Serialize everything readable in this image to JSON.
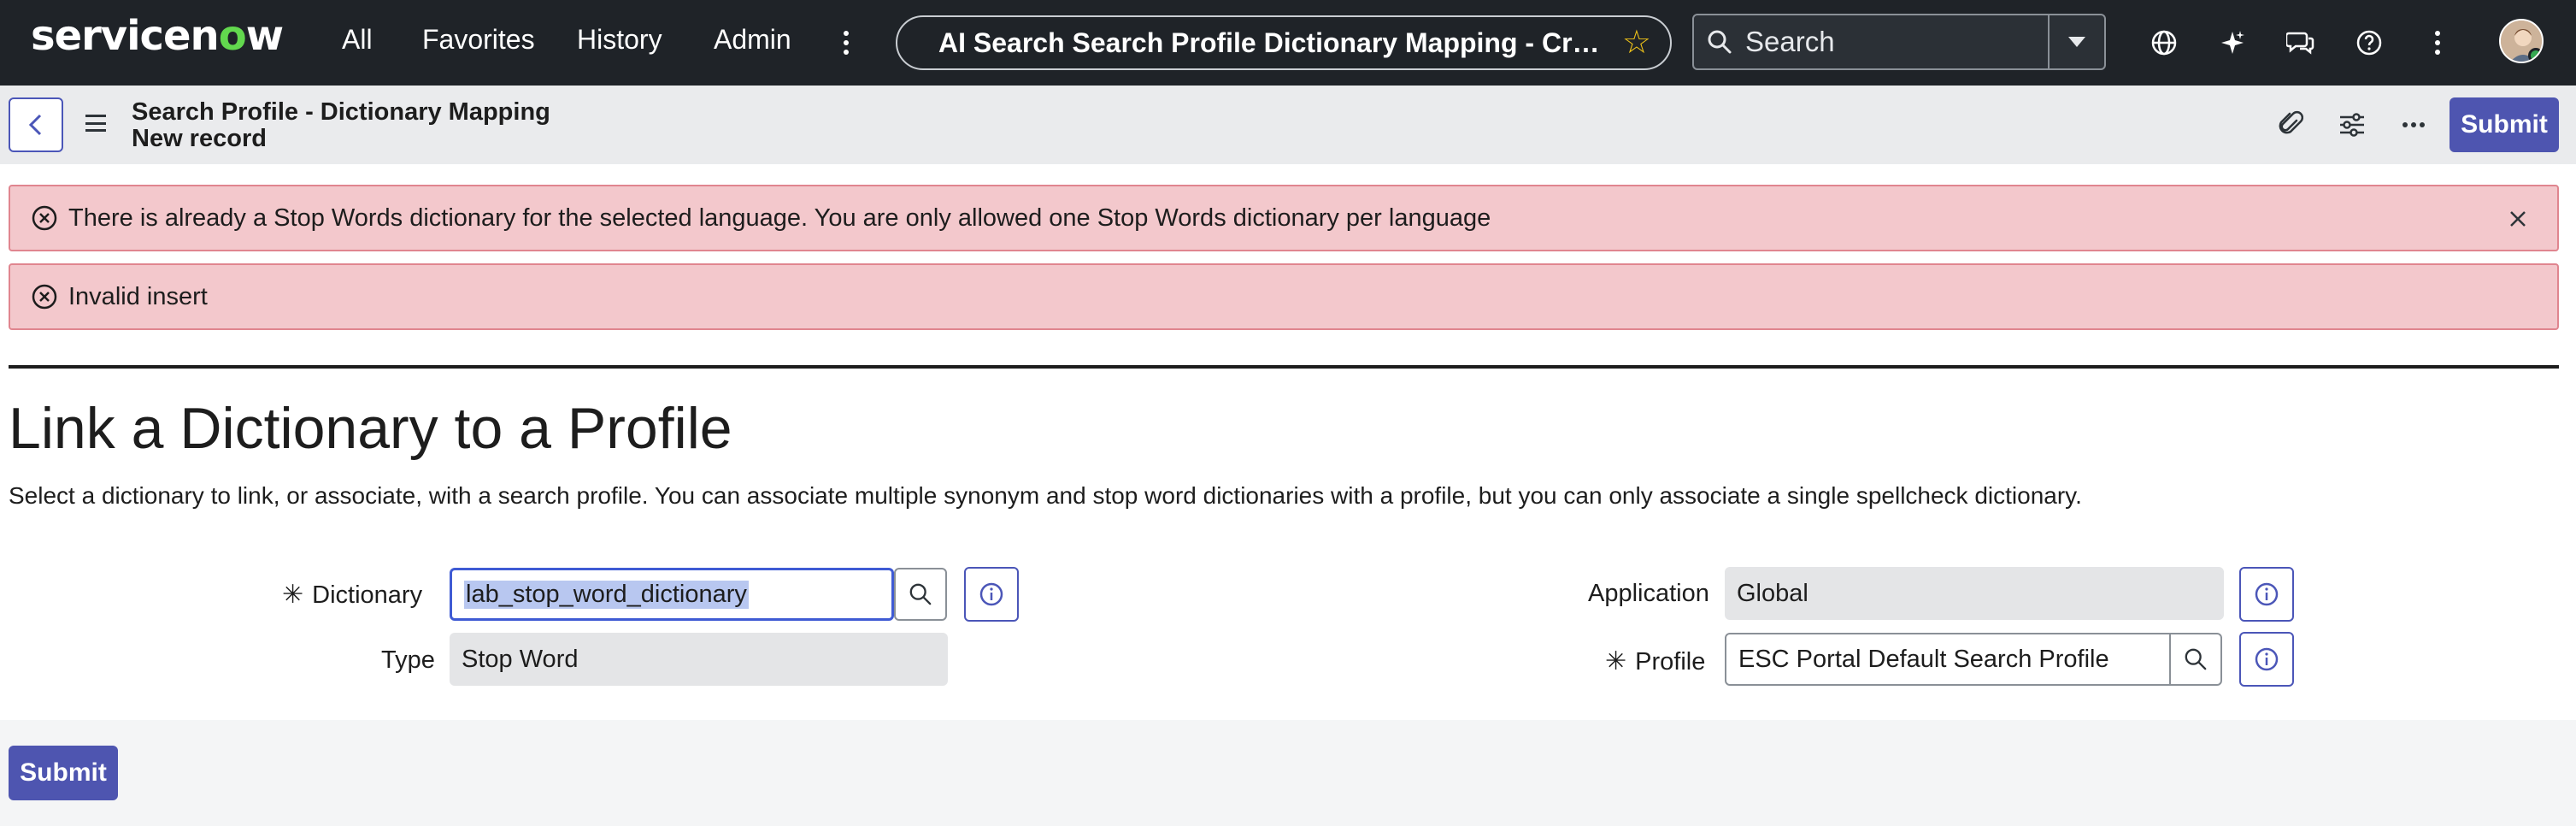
{
  "nav": {
    "logo_prefix": "servicen",
    "logo_o": "o",
    "logo_suffix": "w",
    "links": [
      "All",
      "Favorites",
      "History",
      "Admin"
    ],
    "page_title": "AI Search Search Profile Dictionary Mapping - Create…",
    "search_placeholder": "Search",
    "icons": [
      "globe-icon",
      "sparkle-icon",
      "chat-icon",
      "help-icon",
      "more-icon"
    ]
  },
  "header": {
    "title_line1": "Search Profile - Dictionary Mapping",
    "title_line2": "New record",
    "submit_label": "Submit"
  },
  "alerts": [
    "There is already a Stop Words dictionary for the selected language. You are only allowed one Stop Words dictionary per language",
    "Invalid insert"
  ],
  "form": {
    "title": "Link a Dictionary to a Profile",
    "description": "Select a dictionary to link, or associate, with a search profile. You can associate multiple synonym and stop word dictionaries with a profile, but you can only associate a single spellcheck dictionary.",
    "dictionary_label": "Dictionary",
    "dictionary_value": "lab_stop_word_dictionary",
    "type_label": "Type",
    "type_value": "Stop Word",
    "application_label": "Application",
    "application_value": "Global",
    "profile_label": "Profile",
    "profile_value": "ESC Portal Default Search Profile",
    "required_marker": "✳"
  },
  "footer": {
    "submit_label": "Submit"
  },
  "colors": {
    "nav_bg": "#1f2328",
    "accent": "#4e55b0",
    "alert_bg": "#f3c8cc",
    "alert_border": "#e0858f",
    "logo_green": "#62d84e"
  }
}
